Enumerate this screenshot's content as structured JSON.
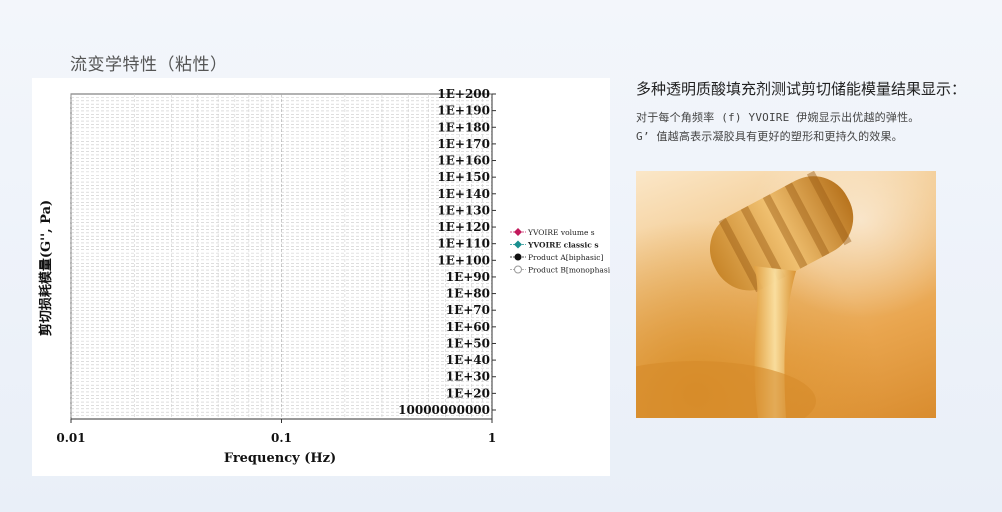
{
  "section_title": "流变学特性（粘性）",
  "right": {
    "heading": "多种透明质酸填充剂测试剪切储能模量结果显示：",
    "line1": "对于每个角频率 (f) YVOIRE 伊婉显示出优越的弹性。",
    "line2": "G’ 值越高表示凝胶具有更好的塑形和更持久的效果。"
  },
  "photo": {
    "subject": "honey dripping from a honey dipper"
  },
  "chart_data": {
    "type": "line",
    "xlabel": "Frequency (Hz)",
    "ylabel": "剪切损耗模量(G'', Pa)",
    "x_scale": "log",
    "xlim": [
      0.01,
      1
    ],
    "x_ticks": [
      "0.01",
      "0.1",
      "1"
    ],
    "y_scale": "log",
    "y_ticks": [
      "10000000000",
      "1E+20",
      "1E+30",
      "1E+40",
      "1E+50",
      "1E+60",
      "1E+70",
      "1E+80",
      "1E+90",
      "1E+100",
      "1E+110",
      "1E+120",
      "1E+130",
      "1E+140",
      "1E+150",
      "1E+160",
      "1E+170",
      "1E+180",
      "1E+190",
      "1E+200"
    ],
    "grid": true,
    "legend_position": "right",
    "series": [
      {
        "name": "YVOIRE volume s",
        "color": "#c2185b",
        "marker": "diamond",
        "values": []
      },
      {
        "name": "YVOIRE classic s",
        "color": "#1a8f8f",
        "marker": "diamond",
        "values": []
      },
      {
        "name": "Product A[biphasic]",
        "color": "#111111",
        "marker": "circle",
        "values": []
      },
      {
        "name": "Product B[monophasic]",
        "color": "#9a9a9a",
        "marker": "circle-open",
        "values": []
      }
    ]
  }
}
